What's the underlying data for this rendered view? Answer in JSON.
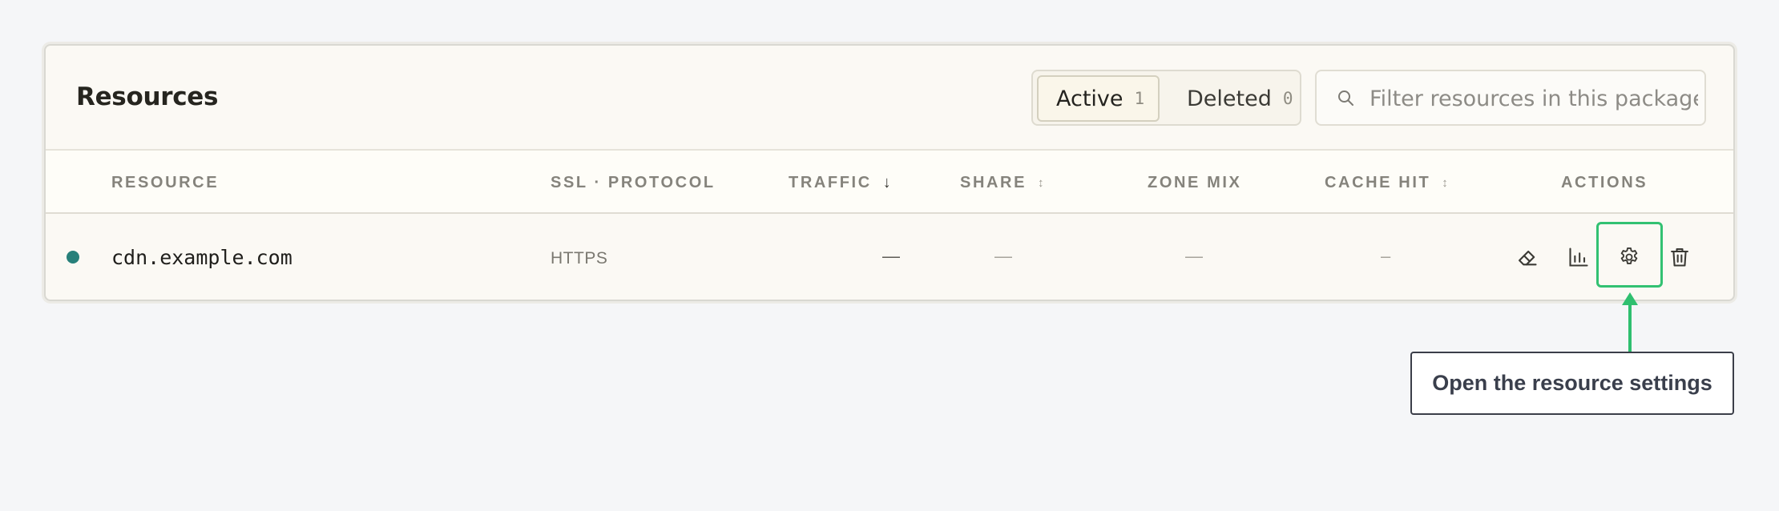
{
  "panel": {
    "title": "Resources",
    "tabs": [
      {
        "label": "Active",
        "count": "1"
      },
      {
        "label": "Deleted",
        "count": "0"
      }
    ],
    "search": {
      "placeholder": "Filter resources in this package",
      "value": ""
    }
  },
  "table": {
    "columns": {
      "resource": "RESOURCE",
      "ssl_protocol": "SSL · PROTOCOL",
      "traffic": "TRAFFIC",
      "traffic_sort": "↓",
      "share": "SHARE",
      "share_sort": "↕",
      "zone_mix": "ZONE MIX",
      "cache_hit": "CACHE HIT",
      "cache_hit_sort": "↕",
      "actions": "ACTIONS"
    },
    "rows": [
      {
        "domain": "cdn.example.com",
        "protocol": "HTTPS",
        "traffic": "—",
        "share": "—",
        "zone_mix": "—",
        "cache_hit": "–",
        "status_color": "#27807a"
      }
    ],
    "actions": [
      "eraser-icon",
      "bar-chart-icon",
      "gear-icon",
      "trash-icon"
    ]
  },
  "annotation": {
    "callout_text": "Open the resource settings",
    "accent_color": "#32c172"
  }
}
